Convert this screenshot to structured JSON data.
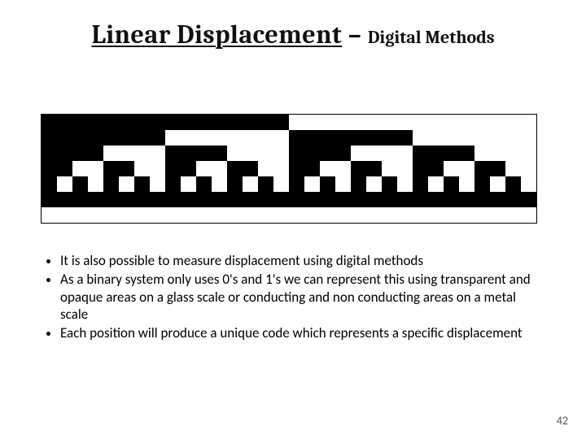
{
  "title": {
    "main": "Linear Displacement",
    "connector": " – ",
    "sub": "Digital Methods"
  },
  "bullets": [
    "It is also possible to measure displacement using digital methods",
    "As a binary system only uses 0's and 1's we can represent this using transparent and opaque areas on a glass scale or conducting and non conducting areas on a metal scale",
    "Each position will produce a unique code which represents a specific displacement"
  ],
  "page_number": "42",
  "encoder": {
    "columns": 32,
    "rows": 7,
    "note": "1 = black (opaque), 0 = white (transparent). Row 0 is top (MSB-like track).",
    "pattern": [
      [
        1,
        1,
        1,
        1,
        1,
        1,
        1,
        1,
        1,
        1,
        1,
        1,
        1,
        1,
        1,
        1,
        0,
        0,
        0,
        0,
        0,
        0,
        0,
        0,
        0,
        0,
        0,
        0,
        0,
        0,
        0,
        0
      ],
      [
        1,
        1,
        1,
        1,
        1,
        1,
        1,
        1,
        0,
        0,
        0,
        0,
        0,
        0,
        0,
        0,
        1,
        1,
        1,
        1,
        1,
        1,
        1,
        1,
        0,
        0,
        0,
        0,
        0,
        0,
        0,
        0
      ],
      [
        1,
        1,
        1,
        1,
        0,
        0,
        0,
        0,
        1,
        1,
        1,
        1,
        0,
        0,
        0,
        0,
        1,
        1,
        1,
        1,
        0,
        0,
        0,
        0,
        1,
        1,
        1,
        1,
        0,
        0,
        0,
        0
      ],
      [
        1,
        1,
        0,
        0,
        1,
        1,
        0,
        0,
        1,
        1,
        0,
        0,
        1,
        1,
        0,
        0,
        1,
        1,
        0,
        0,
        1,
        1,
        0,
        0,
        1,
        1,
        0,
        0,
        1,
        1,
        0,
        0
      ],
      [
        1,
        0,
        1,
        0,
        1,
        0,
        1,
        0,
        1,
        0,
        1,
        0,
        1,
        0,
        1,
        0,
        1,
        0,
        1,
        0,
        1,
        0,
        1,
        0,
        1,
        0,
        1,
        0,
        1,
        0,
        1,
        0
      ],
      [
        1,
        1,
        1,
        1,
        1,
        1,
        1,
        1,
        1,
        1,
        1,
        1,
        1,
        1,
        1,
        1,
        1,
        1,
        1,
        1,
        1,
        1,
        1,
        1,
        1,
        1,
        1,
        1,
        1,
        1,
        1,
        1
      ],
      [
        0,
        0,
        0,
        0,
        0,
        0,
        0,
        0,
        0,
        0,
        0,
        0,
        0,
        0,
        0,
        0,
        0,
        0,
        0,
        0,
        0,
        0,
        0,
        0,
        0,
        0,
        0,
        0,
        0,
        0,
        0,
        0
      ]
    ]
  }
}
